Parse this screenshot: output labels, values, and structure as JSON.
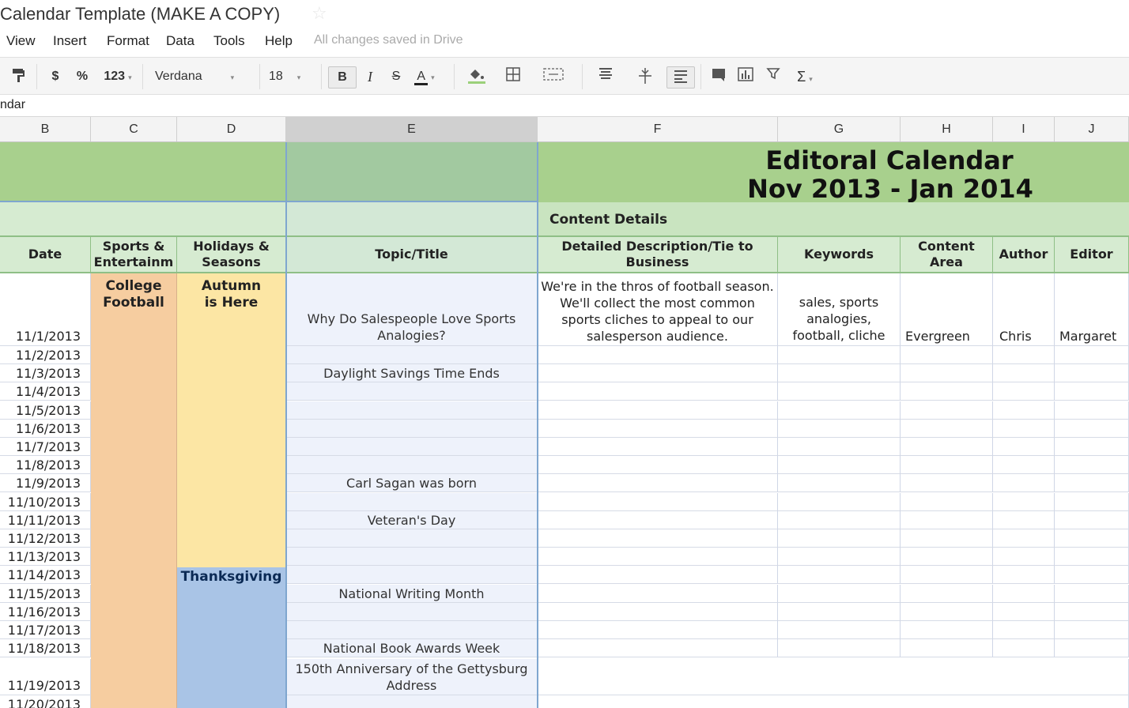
{
  "title_bar": {
    "doc_title": "Calendar Template (MAKE A COPY)",
    "star_icon": "☆"
  },
  "menu": {
    "items": [
      "View",
      "Insert",
      "Format",
      "Data",
      "Tools",
      "Help"
    ],
    "save_status": "All changes saved in Drive"
  },
  "toolbar": {
    "paint_format_icon": "paint-format-icon",
    "currency": "$",
    "percent": "%",
    "number_format": "123",
    "font_family": "Verdana",
    "font_size": "18",
    "bold": "B",
    "italic": "I",
    "strikethrough": "S",
    "text_color": "A",
    "sum_icon": "Σ"
  },
  "formula_bar": {
    "content": "ndar"
  },
  "columns": [
    "B",
    "C",
    "D",
    "E",
    "F",
    "G",
    "H",
    "I",
    "J"
  ],
  "sheet": {
    "title_line1": "Editoral Calendar",
    "title_line2": "Nov 2013 - Jan 2014",
    "content_details": "Content Details",
    "headers": {
      "date": "Date",
      "sports": "Sports & Entertainm",
      "holidays": "Holidays & Seasons",
      "topic": "Topic/Title",
      "description": "Detailed Description/Tie to Business",
      "keywords": "Keywords",
      "content_area": "Content Area",
      "author": "Author",
      "editor": "Editor"
    },
    "sports_label": "College Football",
    "holiday_autumn": "Autumn is Here",
    "holiday_thanksgiving": "Thanksgiving",
    "first_row": {
      "date": "11/1/2013",
      "topic": "Why Do Salespeople Love Sports Analogies?",
      "description": "We're in the thros of football season. We'll collect the most common sports cliches to appeal to our salesperson audience.",
      "keywords": "sales, sports analogies, football, cliche",
      "content_area": "Evergreen",
      "author": "Chris",
      "editor": "Margaret"
    },
    "rows": [
      {
        "date": "11/2/2013",
        "topic": ""
      },
      {
        "date": "11/3/2013",
        "topic": "Daylight Savings Time Ends"
      },
      {
        "date": "11/4/2013",
        "topic": ""
      },
      {
        "date": "11/5/2013",
        "topic": ""
      },
      {
        "date": "11/6/2013",
        "topic": ""
      },
      {
        "date": "11/7/2013",
        "topic": ""
      },
      {
        "date": "11/8/2013",
        "topic": ""
      },
      {
        "date": "11/9/2013",
        "topic": "Carl Sagan was born"
      },
      {
        "date": "11/10/2013",
        "topic": ""
      },
      {
        "date": "11/11/2013",
        "topic": "Veteran's Day"
      },
      {
        "date": "11/12/2013",
        "topic": ""
      },
      {
        "date": "11/13/2013",
        "topic": ""
      },
      {
        "date": "11/14/2013",
        "topic": ""
      },
      {
        "date": "11/15/2013",
        "topic": "National Writing Month"
      },
      {
        "date": "11/16/2013",
        "topic": ""
      },
      {
        "date": "11/17/2013",
        "topic": ""
      },
      {
        "date": "11/18/2013",
        "topic": "National Book Awards Week"
      }
    ],
    "tall_row": {
      "date": "11/19/2013",
      "topic": "150th Anniversary of the Gettysburg Address"
    },
    "last_row": {
      "date": "11/20/2013"
    }
  },
  "colors": {
    "title_green": "#a8d08d",
    "header_green": "#d6ebd1",
    "sports_orange": "#f6cda0",
    "autumn_yellow": "#fce6a4",
    "thanksgiving_blue": "#a9c4e6",
    "topic_bg": "#eef2fb"
  }
}
